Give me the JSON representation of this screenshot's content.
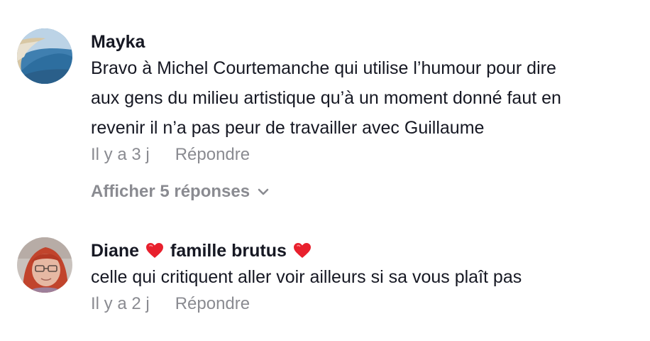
{
  "comments": [
    {
      "username": "Mayka",
      "text_lines": [
        "Bravo à Michel Courtemanche qui utilise l’humour pour dire",
        "aux gens du milieu artistique qu’à un moment donné faut en",
        "revenir il n’a pas peur de travailler avec Guillaume"
      ],
      "timestamp": "Il y a 3 j",
      "reply_label": "Répondre",
      "view_replies_label": "Afficher 5 réponses"
    },
    {
      "username_part1": "Diane",
      "username_part2": "famille brutus",
      "text": "celle qui critiquent aller voir ailleurs si sa vous plaît pas",
      "timestamp": "Il y a 2 j",
      "reply_label": "Répondre"
    }
  ],
  "colors": {
    "text_primary": "#161823",
    "text_secondary": "#8a8b91",
    "heart": "#e8202d"
  },
  "icons": {
    "heart": "heart-emoji-icon",
    "chevron": "chevron-down-icon"
  }
}
